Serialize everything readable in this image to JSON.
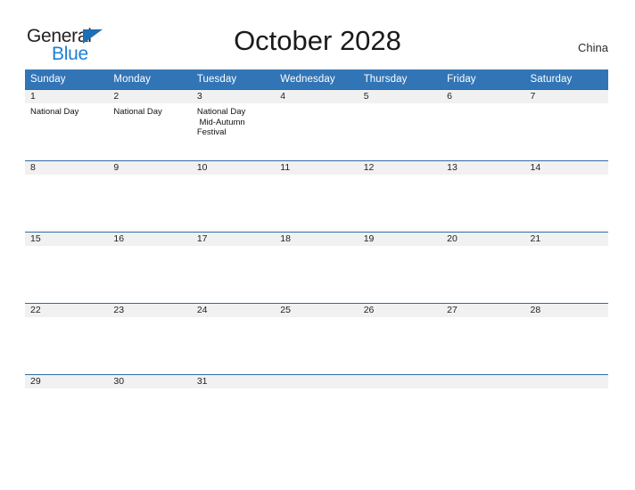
{
  "brand": {
    "name_part1": "General",
    "name_part2": "Blue",
    "triangle_icon": "triangle-icon"
  },
  "header": {
    "title": "October 2028",
    "region": "China"
  },
  "colors": {
    "header_blue": "#3275b6",
    "date_band_gray": "#f1f1f1",
    "date_band_border": "#2f6ca5",
    "brand_dark": "#231f20",
    "brand_blue": "#1c7fd6",
    "triangle_blue": "#1c6fb5"
  },
  "calendar": {
    "weekday_headers": [
      "Sunday",
      "Monday",
      "Tuesday",
      "Wednesday",
      "Thursday",
      "Friday",
      "Saturday"
    ],
    "weeks": [
      [
        {
          "date": "1",
          "events": "National Day"
        },
        {
          "date": "2",
          "events": "National Day"
        },
        {
          "date": "3",
          "events": "National Day\n Mid-Autumn Festival"
        },
        {
          "date": "4",
          "events": ""
        },
        {
          "date": "5",
          "events": ""
        },
        {
          "date": "6",
          "events": ""
        },
        {
          "date": "7",
          "events": ""
        }
      ],
      [
        {
          "date": "8",
          "events": ""
        },
        {
          "date": "9",
          "events": ""
        },
        {
          "date": "10",
          "events": ""
        },
        {
          "date": "11",
          "events": ""
        },
        {
          "date": "12",
          "events": ""
        },
        {
          "date": "13",
          "events": ""
        },
        {
          "date": "14",
          "events": ""
        }
      ],
      [
        {
          "date": "15",
          "events": ""
        },
        {
          "date": "16",
          "events": ""
        },
        {
          "date": "17",
          "events": ""
        },
        {
          "date": "18",
          "events": ""
        },
        {
          "date": "19",
          "events": ""
        },
        {
          "date": "20",
          "events": ""
        },
        {
          "date": "21",
          "events": ""
        }
      ],
      [
        {
          "date": "22",
          "events": ""
        },
        {
          "date": "23",
          "events": ""
        },
        {
          "date": "24",
          "events": ""
        },
        {
          "date": "25",
          "events": ""
        },
        {
          "date": "26",
          "events": ""
        },
        {
          "date": "27",
          "events": ""
        },
        {
          "date": "28",
          "events": ""
        }
      ],
      [
        {
          "date": "29",
          "events": ""
        },
        {
          "date": "30",
          "events": ""
        },
        {
          "date": "31",
          "events": ""
        },
        {
          "date": "",
          "events": ""
        },
        {
          "date": "",
          "events": ""
        },
        {
          "date": "",
          "events": ""
        },
        {
          "date": "",
          "events": ""
        }
      ]
    ]
  }
}
